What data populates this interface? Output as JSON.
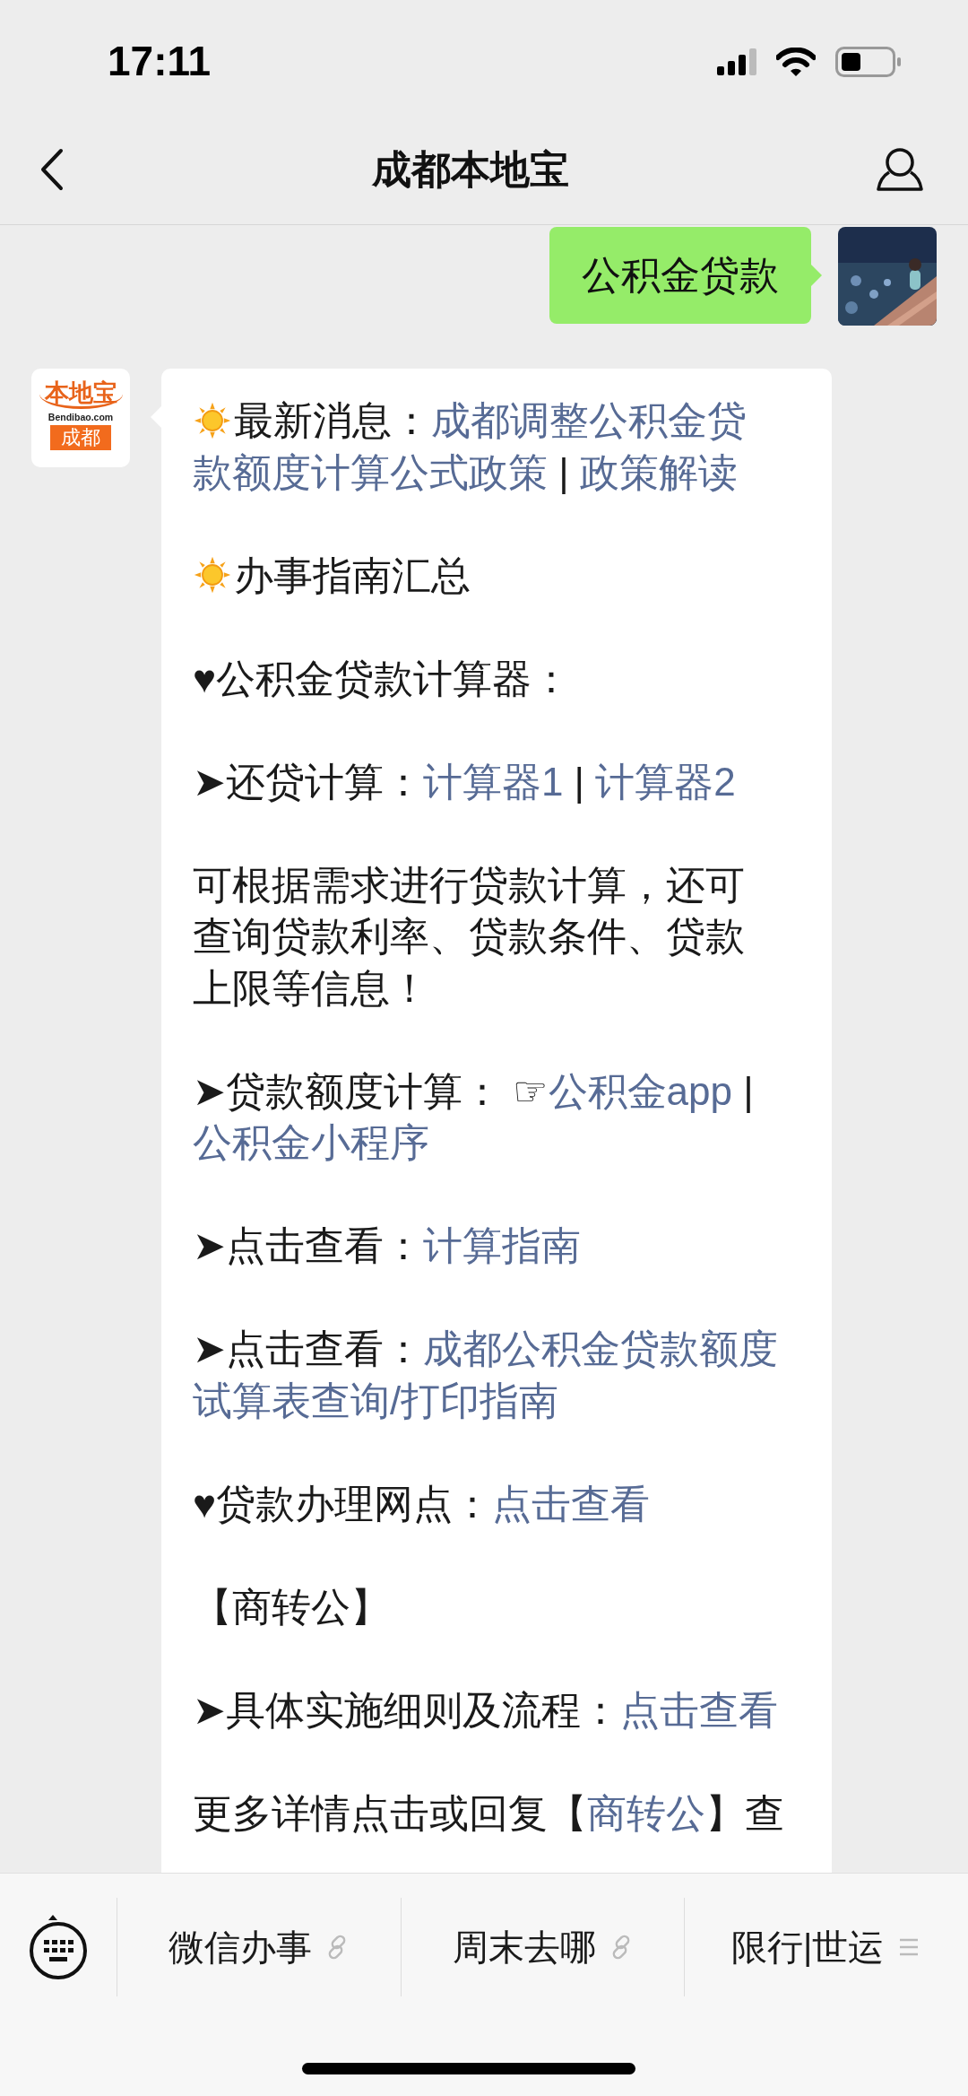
{
  "status_bar": {
    "time": "17:11"
  },
  "nav": {
    "title": "成都本地宝"
  },
  "messages": [
    {
      "kind": "sent",
      "text": "公积金贷款"
    },
    {
      "kind": "received",
      "logo": {
        "brand": "本地宝",
        "domain": "Bendibao.com",
        "city": "成都"
      },
      "paragraphs": [
        [
          [
            {
              "kind": "sun"
            },
            {
              "kind": "text",
              "text": "最新消息："
            },
            {
              "kind": "link",
              "text": "成都调整公积金贷"
            }
          ],
          [
            {
              "kind": "link",
              "text": "款额度计算公式政策"
            },
            {
              "kind": "text",
              "text": " | "
            },
            {
              "kind": "link",
              "text": "政策解读"
            }
          ]
        ],
        [
          [
            {
              "kind": "sun"
            },
            {
              "kind": "text",
              "text": "办事指南汇总"
            }
          ]
        ],
        [
          [
            {
              "kind": "text",
              "text": "♥公积金贷款计算器："
            }
          ]
        ],
        [
          [
            {
              "kind": "text",
              "text": "➤还贷计算："
            },
            {
              "kind": "link",
              "text": "计算器1"
            },
            {
              "kind": "text",
              "text": " | "
            },
            {
              "kind": "link",
              "text": "计算器2"
            }
          ]
        ],
        [
          [
            {
              "kind": "text",
              "text": "可根据需求进行贷款计算，还可"
            }
          ],
          [
            {
              "kind": "text",
              "text": "查询贷款利率、贷款条件、贷款"
            }
          ],
          [
            {
              "kind": "text",
              "text": "上限等信息！"
            }
          ]
        ],
        [
          [
            {
              "kind": "text",
              "text": "➤贷款额度计算： ☞"
            },
            {
              "kind": "link",
              "text": "公积金app"
            },
            {
              "kind": "text",
              "text": " |"
            }
          ],
          [
            {
              "kind": "link",
              "text": "公积金小程序"
            }
          ]
        ],
        [
          [
            {
              "kind": "text",
              "text": "➤点击查看："
            },
            {
              "kind": "link",
              "text": "计算指南"
            }
          ]
        ],
        [
          [
            {
              "kind": "text",
              "text": "➤点击查看："
            },
            {
              "kind": "link",
              "text": "成都公积金贷款额度"
            }
          ],
          [
            {
              "kind": "link",
              "text": "试算表查询/打印指南"
            }
          ]
        ],
        [
          [
            {
              "kind": "text",
              "text": "♥贷款办理网点："
            },
            {
              "kind": "link",
              "text": "点击查看"
            }
          ]
        ],
        [
          [
            {
              "kind": "text",
              "text": "【商转公】"
            }
          ]
        ],
        [
          [
            {
              "kind": "text",
              "text": "➤具体实施细则及流程："
            },
            {
              "kind": "link",
              "text": "点击查看"
            }
          ]
        ],
        [
          [
            {
              "kind": "text",
              "text": "更多详情点击或回复【"
            },
            {
              "kind": "link",
              "text": "商转公"
            },
            {
              "kind": "text",
              "text": "】查"
            }
          ]
        ]
      ]
    }
  ],
  "menu": [
    {
      "label": "微信办事",
      "kind": "link"
    },
    {
      "label": "周末去哪",
      "kind": "link"
    },
    {
      "label": "限行|世运",
      "kind": "list"
    }
  ]
}
